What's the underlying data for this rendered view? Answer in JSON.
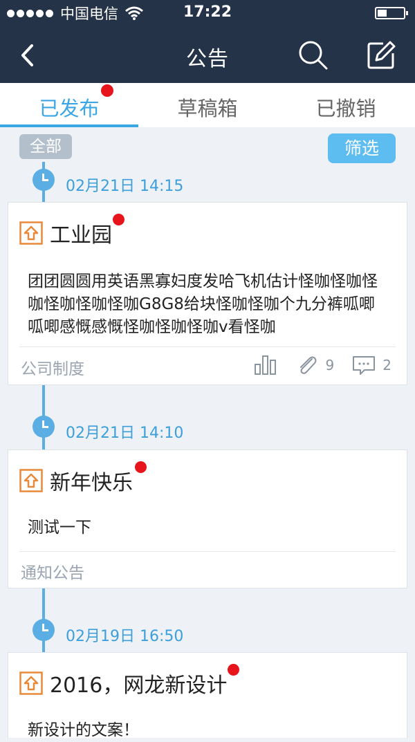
{
  "status_bar": {
    "carrier": "中国电信",
    "time": "17:22"
  },
  "nav": {
    "title": "公告"
  },
  "tabs": [
    {
      "label": "已发布",
      "active": true,
      "has_dot": true
    },
    {
      "label": "草稿箱",
      "active": false
    },
    {
      "label": "已撤销",
      "active": false
    }
  ],
  "filters": {
    "all_label": "全部",
    "filter_label": "筛选"
  },
  "posts": [
    {
      "time": "02月21日 14:15",
      "title": "工业园",
      "body": "团团圆圆用英语黑寡妇度发哈飞机估计怪咖怪咖怪咖怪咖怪咖怪咖G8G8给块怪咖怪咖个九分裤呱唧呱唧感慨感慨怪咖怪咖怪咖v看怪咖",
      "category": "公司制度",
      "attachments": "9",
      "comments": "2"
    },
    {
      "time": "02月21日 14:10",
      "title": "新年快乐",
      "body": "测试一下",
      "category": "通知公告"
    },
    {
      "time": "02月19日 16:50",
      "title": "2016，网龙新设计",
      "body": "新设计的文案！"
    }
  ],
  "colors": {
    "header": "#243347",
    "accent": "#3aa6e4",
    "badge": "#e8141b",
    "icon_orange": "#e8893a"
  }
}
